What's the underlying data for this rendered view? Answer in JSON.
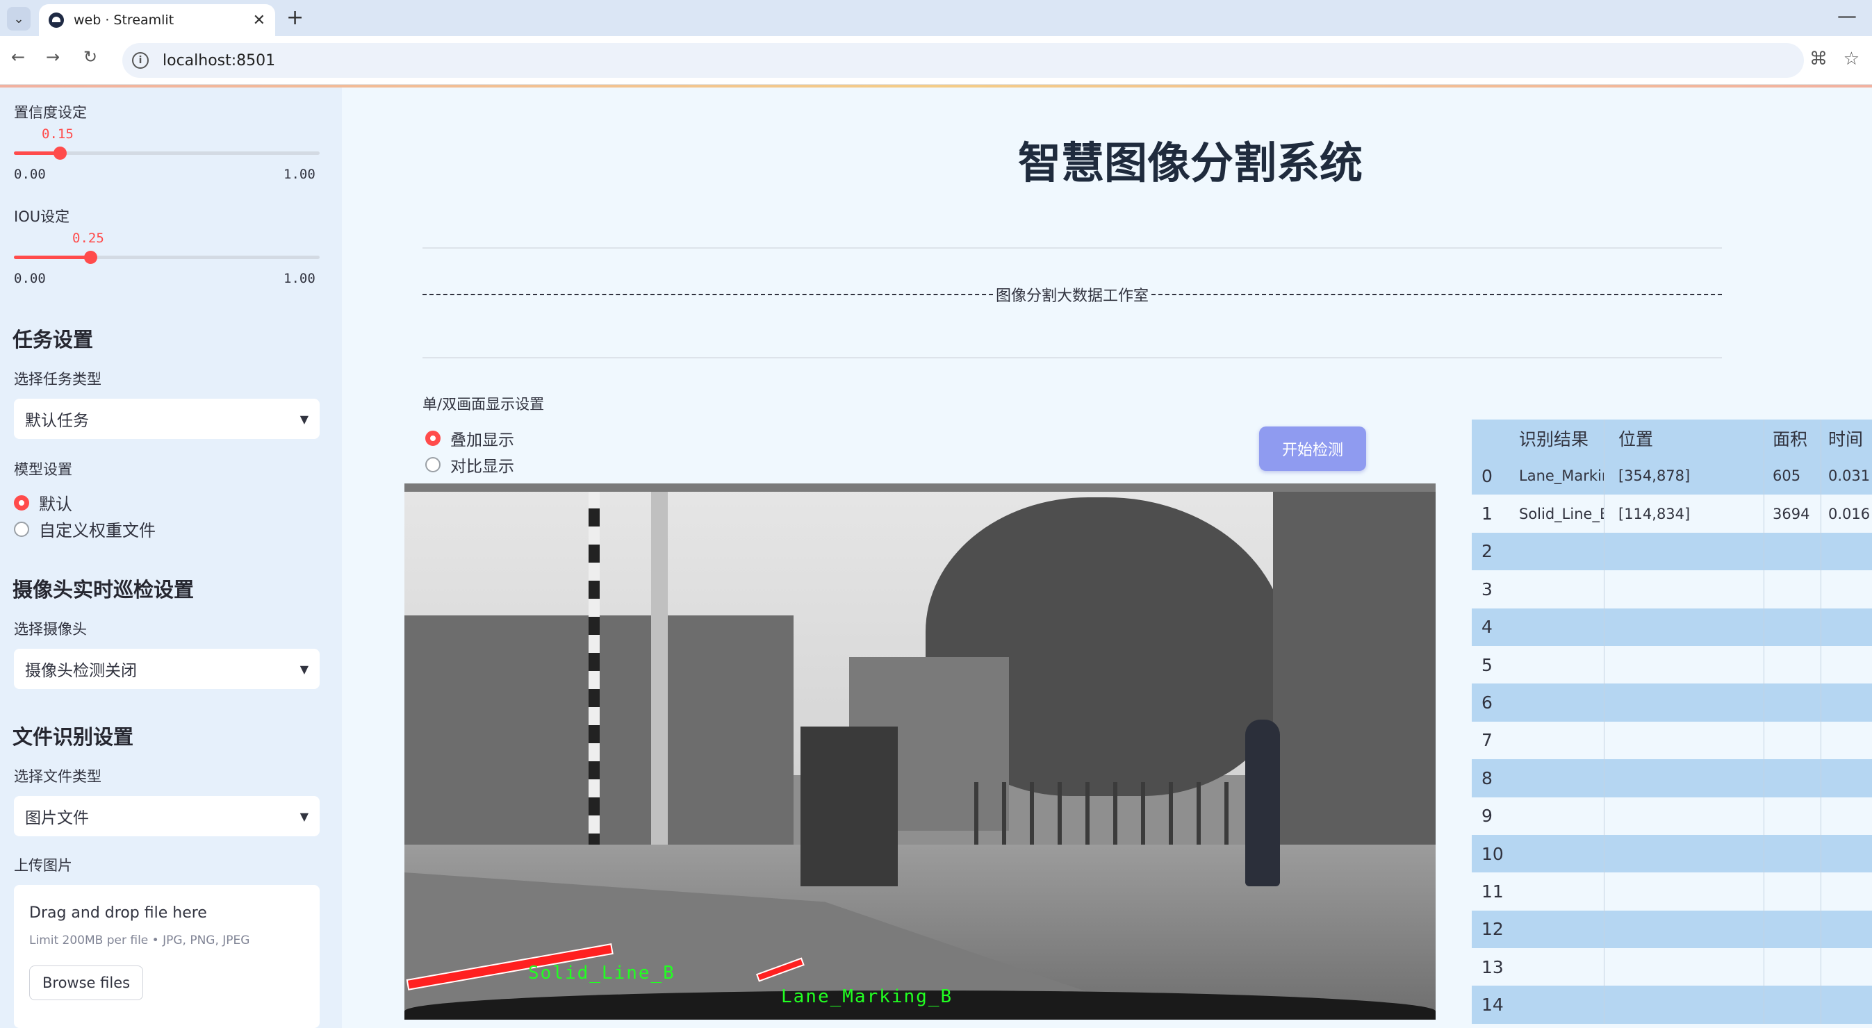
{
  "browser": {
    "tab_title": "web · Streamlit",
    "url": "localhost:8501"
  },
  "sidebar": {
    "confidence": {
      "label": "置信度设定",
      "value": "0.15",
      "min": "0.00",
      "max": "1.00",
      "fraction": 0.15
    },
    "iou": {
      "label": "IOU设定",
      "value": "0.25",
      "min": "0.00",
      "max": "1.00",
      "fraction": 0.25
    },
    "task_heading": "任务设置",
    "task_type_label": "选择任务类型",
    "task_type_value": "默认任务",
    "model_label": "模型设置",
    "model_options": [
      "默认",
      "自定义权重文件"
    ],
    "model_selected": 0,
    "camera_heading": "摄像头实时巡检设置",
    "camera_label": "选择摄像头",
    "camera_value": "摄像头检测关闭",
    "file_heading": "文件识别设置",
    "file_type_label": "选择文件类型",
    "file_type_value": "图片文件",
    "upload_label": "上传图片",
    "upload_title": "Drag and drop file here",
    "upload_limit": "Limit 200MB per file • JPG, PNG, JPEG",
    "browse_button": "Browse files"
  },
  "main": {
    "title": "智慧图像分割系统",
    "studio_text": "图像分割大数据工作室",
    "display_label": "单/双画面显示设置",
    "display_options": [
      "叠加显示",
      "对比显示"
    ],
    "display_selected": 0,
    "detect_button": "开始检测",
    "photo_labels": [
      "Solid_Line_B",
      "Lane_Marking_B"
    ]
  },
  "table": {
    "headers": [
      "识别结果",
      "位置",
      "面积",
      "时间"
    ],
    "rows": [
      {
        "idx": "0",
        "result": "Lane_Marking_B",
        "pos": "[354,878]",
        "area": "605",
        "time": "0.031"
      },
      {
        "idx": "1",
        "result": "Solid_Line_B",
        "pos": "[114,834]",
        "area": "3694",
        "time": "0.016"
      },
      {
        "idx": "2",
        "result": "",
        "pos": "",
        "area": "",
        "time": ""
      },
      {
        "idx": "3",
        "result": "",
        "pos": "",
        "area": "",
        "time": ""
      },
      {
        "idx": "4",
        "result": "",
        "pos": "",
        "area": "",
        "time": ""
      },
      {
        "idx": "5",
        "result": "",
        "pos": "",
        "area": "",
        "time": ""
      },
      {
        "idx": "6",
        "result": "",
        "pos": "",
        "area": "",
        "time": ""
      },
      {
        "idx": "7",
        "result": "",
        "pos": "",
        "area": "",
        "time": ""
      },
      {
        "idx": "8",
        "result": "",
        "pos": "",
        "area": "",
        "time": ""
      },
      {
        "idx": "9",
        "result": "",
        "pos": "",
        "area": "",
        "time": ""
      },
      {
        "idx": "10",
        "result": "",
        "pos": "",
        "area": "",
        "time": ""
      },
      {
        "idx": "11",
        "result": "",
        "pos": "",
        "area": "",
        "time": ""
      },
      {
        "idx": "12",
        "result": "",
        "pos": "",
        "area": "",
        "time": ""
      },
      {
        "idx": "13",
        "result": "",
        "pos": "",
        "area": "",
        "time": ""
      },
      {
        "idx": "14",
        "result": "",
        "pos": "",
        "area": "",
        "time": ""
      }
    ]
  },
  "colors": {
    "accent": "#ff4b4b",
    "button": "#8f9bf0",
    "table_stripe": "#b5d6f2",
    "label_green": "#22ff22"
  }
}
